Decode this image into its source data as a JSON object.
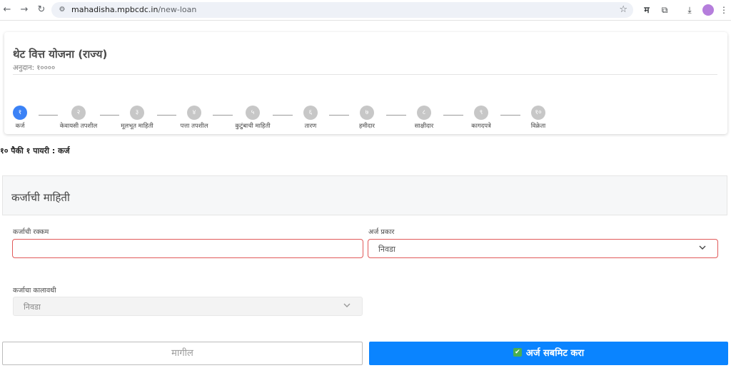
{
  "browser": {
    "url_host": "mahadisha.mpbcdc.in",
    "url_path": "/new-loan",
    "ext_letter": "म"
  },
  "card": {
    "title": "थेट वित्त योजना (राज्य)",
    "subtitle": "अनुदान: १००००"
  },
  "steps": [
    {
      "num": "१",
      "label": "कर्ज",
      "active": true
    },
    {
      "num": "२",
      "label": "केवायसी तपशील"
    },
    {
      "num": "३",
      "label": "मूलभूत माहिती"
    },
    {
      "num": "४",
      "label": "पत्ता तपशील"
    },
    {
      "num": "५",
      "label": "कुटुंबाची माहिती"
    },
    {
      "num": "६",
      "label": "तारण"
    },
    {
      "num": "७",
      "label": "हमीदार"
    },
    {
      "num": "८",
      "label": "साक्षीदार"
    },
    {
      "num": "९",
      "label": "कागदपत्रे"
    },
    {
      "num": "१०",
      "label": "विक्रेता"
    }
  ],
  "progress_text": "१० पैकी १ पायरी : कर्ज",
  "section": {
    "title": "कर्जाची माहिती"
  },
  "form": {
    "loan_amount_label": "कर्जाची रक्कम",
    "loan_amount_value": "",
    "application_type_label": "अर्ज प्रकार",
    "application_type_value": "निवडा",
    "loan_tenure_label": "कर्जाचा कालावधी",
    "loan_tenure_value": "निवडा"
  },
  "buttons": {
    "previous": "मागील",
    "submit": "अर्ज सबमिट करा"
  }
}
